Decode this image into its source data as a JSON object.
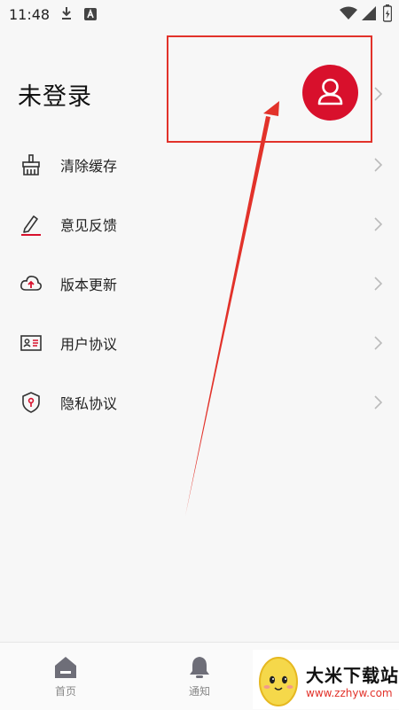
{
  "status_bar": {
    "time": "11:48"
  },
  "profile": {
    "login_status": "未登录"
  },
  "menu": {
    "items": [
      {
        "label": "清除缓存",
        "icon": "broom-icon"
      },
      {
        "label": "意见反馈",
        "icon": "pen-icon"
      },
      {
        "label": "版本更新",
        "icon": "cloud-upload-icon"
      },
      {
        "label": "用户协议",
        "icon": "id-card-icon"
      },
      {
        "label": "隐私协议",
        "icon": "shield-icon"
      }
    ]
  },
  "bottom_nav": {
    "items": [
      {
        "label": "首页",
        "icon": "home-icon"
      },
      {
        "label": "通知",
        "icon": "bell-icon"
      }
    ]
  },
  "watermark": {
    "title": "大米下载站",
    "url": "www.zzhyw.com"
  },
  "colors": {
    "accent": "#d8102c",
    "annotation": "#e2322a",
    "background": "#f7f7f7"
  }
}
